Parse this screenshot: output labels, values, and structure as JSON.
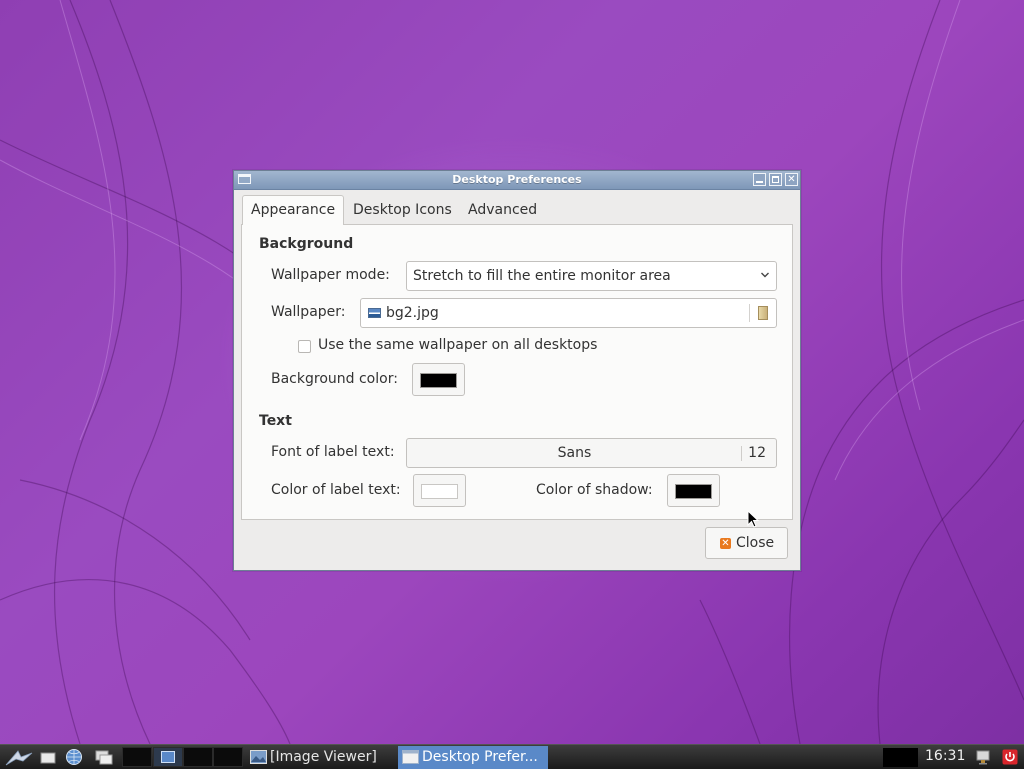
{
  "window": {
    "title": "Desktop Preferences",
    "buttons": [
      "minimize",
      "maximize",
      "close"
    ]
  },
  "tabs": [
    {
      "label": "Appearance",
      "active": true
    },
    {
      "label": "Desktop Icons",
      "active": false
    },
    {
      "label": "Advanced",
      "active": false
    }
  ],
  "background_section": {
    "title": "Background",
    "wallpaper_mode_label": "Wallpaper mode:",
    "wallpaper_mode_value": "Stretch to fill the entire monitor area",
    "wallpaper_label": "Wallpaper:",
    "wallpaper_file": "bg2.jpg",
    "same_wallpaper_label": "Use the same wallpaper on all desktops",
    "same_wallpaper_checked": false,
    "background_color_label": "Background color:",
    "background_color": "#000000"
  },
  "text_section": {
    "title": "Text",
    "font_label": "Font of label text:",
    "font_name": "Sans",
    "font_size": "12",
    "label_color_label": "Color of label text:",
    "label_color": "#ffffff",
    "shadow_color_label": "Color of shadow:",
    "shadow_color": "#000000"
  },
  "footer": {
    "close_label": "Close",
    "close_icon": "close-icon"
  },
  "taskbar": {
    "launchers": [
      "menu-icon",
      "file-manager-icon",
      "web-browser-icon",
      "window-list-icon"
    ],
    "tasks": [
      {
        "label": "[Image Viewer]",
        "active": false
      },
      {
        "label": "Desktop Prefer...",
        "active": true
      }
    ],
    "clock": "16:31"
  },
  "colors": {
    "accent": "#5a89c8",
    "titlebar": "#8ea4c2",
    "close_icon": "#e9791e",
    "desktop": "#9a4bc0"
  }
}
